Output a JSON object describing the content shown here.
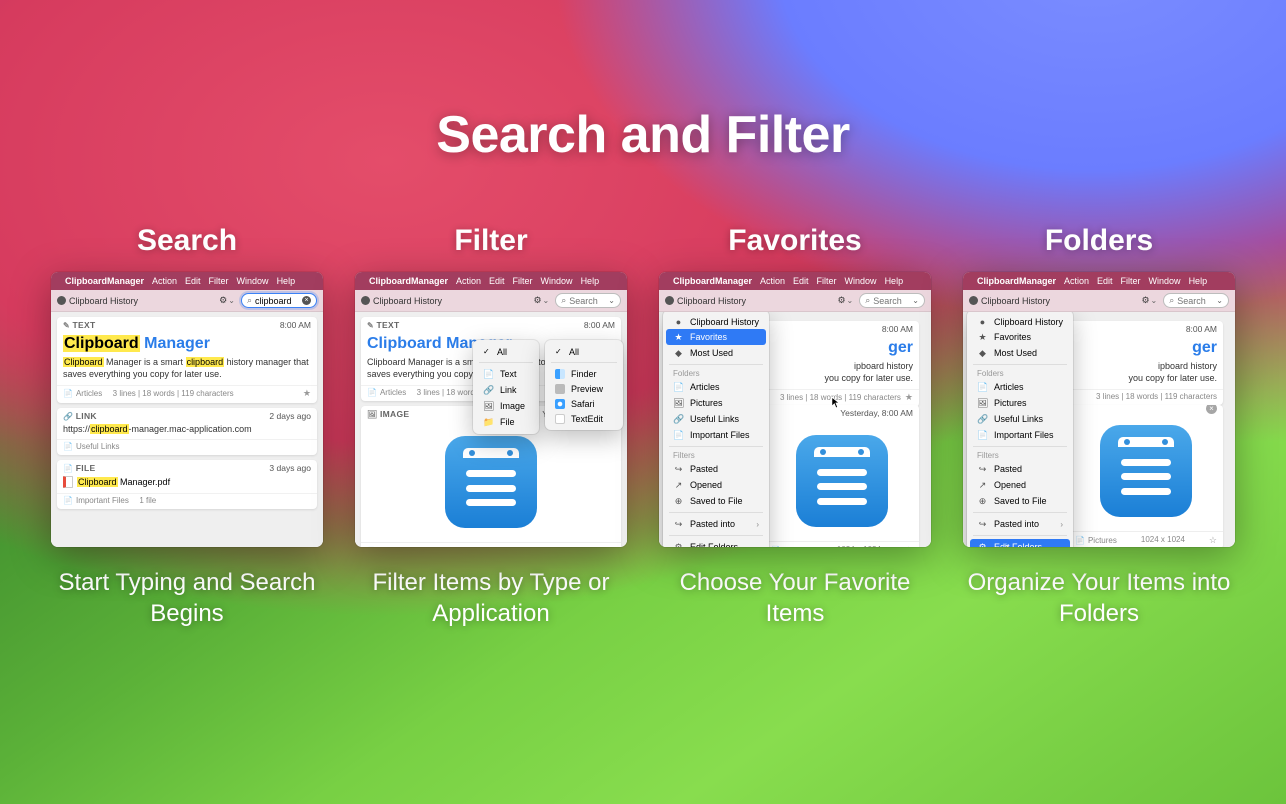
{
  "hero": "Search and Filter",
  "menu": {
    "app": "ClipboardManager",
    "items": [
      "Action",
      "Edit",
      "Filter",
      "Window",
      "Help"
    ]
  },
  "windowTitle": "Clipboard History",
  "searchPlaceholder": "Search",
  "columns": [
    {
      "heading": "Search",
      "caption": "Start Typing and Search Begins"
    },
    {
      "heading": "Filter",
      "caption": "Filter Items by Type or Application"
    },
    {
      "heading": "Favorites",
      "caption": "Choose Your Favorite Items"
    },
    {
      "heading": "Folders",
      "caption": "Organize Your Items into Folders"
    }
  ],
  "searchValue": "clipboard",
  "cards": {
    "text": {
      "type": "TEXT",
      "time": "8:00 AM",
      "title_hl": "Clipboard",
      "title_rest": "Manager",
      "desc_parts": [
        "Clipboard",
        " Manager is a smart ",
        "clipboard",
        " history manager that saves everything you copy for later use."
      ],
      "folder": "Articles",
      "meta": "3 lines | 18 words | 119 characters"
    },
    "textPlain": {
      "type": "TEXT",
      "time": "8:00 AM",
      "title": "Clipboard Manager",
      "desc": "Clipboard Manager is a smart clipboard history manager that saves everything you copy for later use.",
      "folder": "Articles",
      "meta": "3 lines | 18 words | 119 characters"
    },
    "link": {
      "type": "LINK",
      "time": "2 days ago",
      "url_pre": "https://",
      "url_hl": "clipboard",
      "url_post": "-manager.mac-application.com",
      "folder": "Useful Links"
    },
    "file": {
      "type": "FILE",
      "time": "3 days ago",
      "name_hl": "Clipboard",
      "name_post": " Manager.pdf",
      "folder": "Important Files",
      "meta": "1 file"
    },
    "image": {
      "type": "IMAGE",
      "time": "Yesterday, 8:00 AM",
      "folder": "Pictures",
      "meta": "1024 x 1024"
    }
  },
  "filterType": {
    "all": "All",
    "items": [
      "Text",
      "Link",
      "Image",
      "File"
    ],
    "icons": [
      "📄",
      "🔗",
      "🖼",
      "📁"
    ]
  },
  "filterApp": {
    "all": "All",
    "items": [
      "Finder",
      "Preview",
      "Safari",
      "TextEdit"
    ]
  },
  "dropdown": {
    "history": "Clipboard History",
    "favorites": "Favorites",
    "mostUsed": "Most Used",
    "foldersLabel": "Folders",
    "folders": [
      "Articles",
      "Pictures",
      "Useful Links",
      "Important Files"
    ],
    "filtersLabel": "Filters",
    "filters": [
      "Pasted",
      "Opened",
      "Saved to File"
    ],
    "pastedInto": "Pasted into",
    "editFolders": "Edit Folders..."
  }
}
